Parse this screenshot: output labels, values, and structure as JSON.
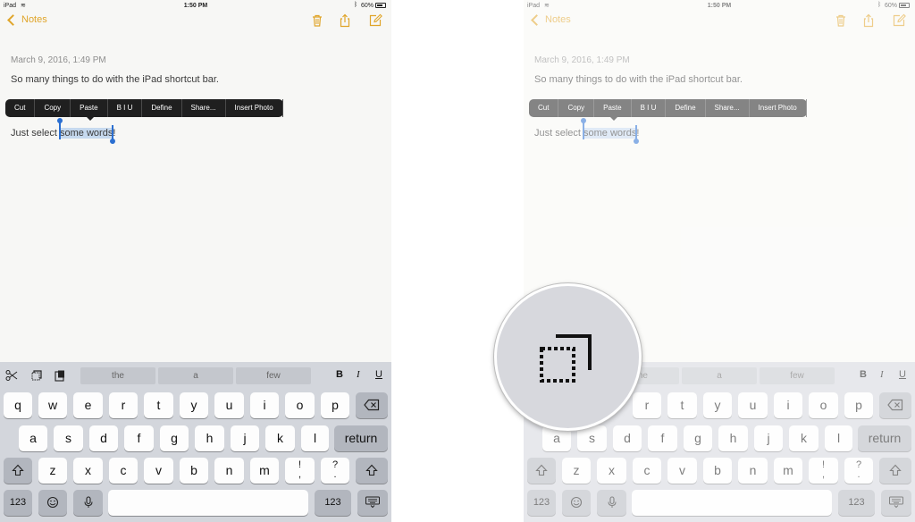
{
  "status": {
    "carrier": "iPad",
    "time": "1:50 PM",
    "battery": "60%"
  },
  "nav": {
    "back_label": "Notes"
  },
  "note": {
    "date": "March 9, 2016, 1:49 PM",
    "line1": "So many things to do with the iPad shortcut bar.",
    "line2_before": "Just select ",
    "line2_selected": "some words",
    "line2_after": "!"
  },
  "edit_menu": {
    "cut": "Cut",
    "copy": "Copy",
    "paste": "Paste",
    "biu": "B I U",
    "define": "Define",
    "share": "Share...",
    "insert_photo": "Insert Photo"
  },
  "shortcut_bar": {
    "suggestions": [
      "the",
      "a",
      "few"
    ],
    "bold": "B",
    "italic": "I",
    "underline": "U"
  },
  "keyboard": {
    "row1": [
      "q",
      "w",
      "e",
      "r",
      "t",
      "y",
      "u",
      "i",
      "o",
      "p"
    ],
    "row2": [
      "a",
      "s",
      "d",
      "f",
      "g",
      "h",
      "j",
      "k",
      "l"
    ],
    "row3": [
      "z",
      "x",
      "c",
      "v",
      "b",
      "n",
      "m"
    ],
    "punct1_top": "!",
    "punct1_bottom": ",",
    "punct2_top": "?",
    "punct2_bottom": ".",
    "return": "return",
    "numbers": "123"
  },
  "icons": {
    "loupe": "copy-icon",
    "colors": {
      "accent": "#e0a52a",
      "selection": "#2b6fd1"
    }
  }
}
